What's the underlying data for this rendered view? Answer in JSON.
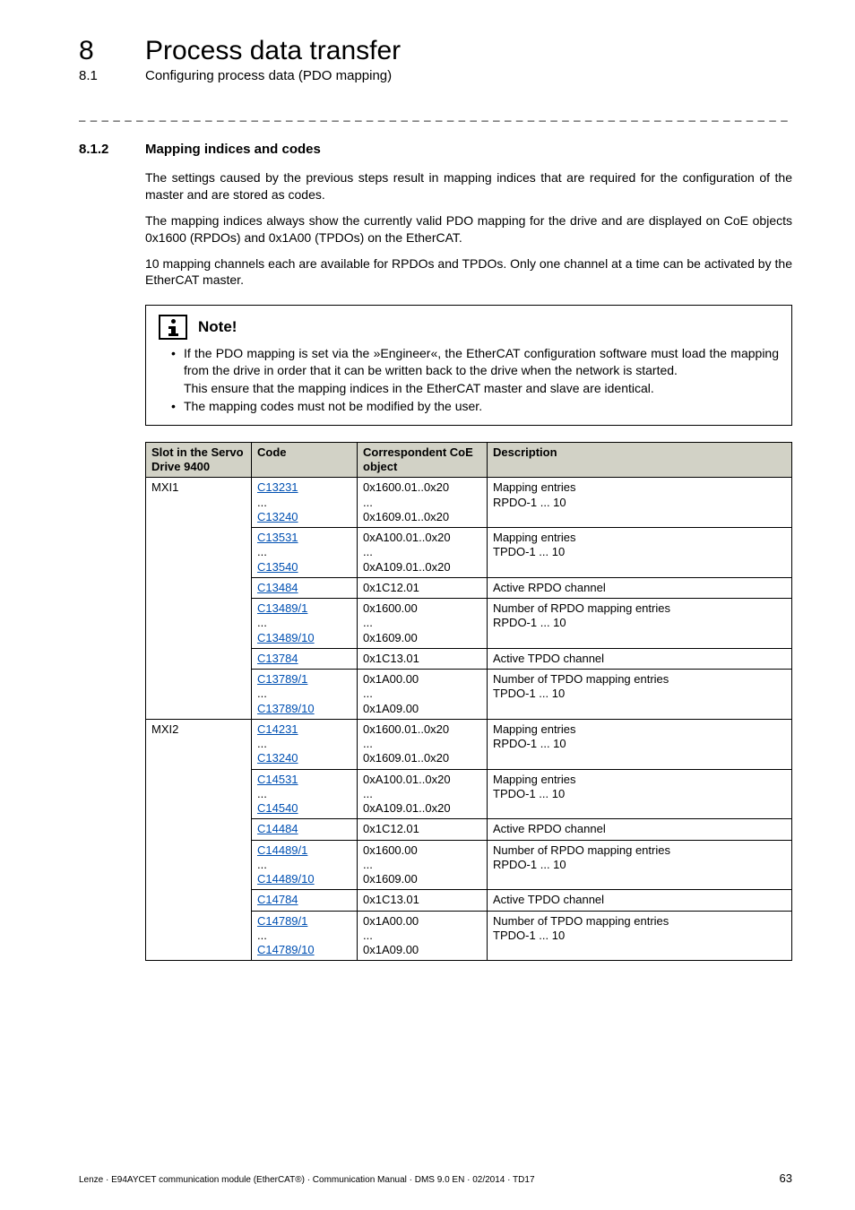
{
  "header": {
    "chapter_num": "8",
    "chapter_title": "Process data transfer",
    "section_num": "8.1",
    "section_title": "Configuring process data (PDO mapping)"
  },
  "separator": "_ _ _ _ _ _ _ _ _ _ _ _ _ _ _ _ _ _ _ _ _ _ _ _ _ _ _ _ _ _ _ _ _ _ _ _ _ _ _ _ _ _ _ _ _ _ _ _ _ _ _ _ _ _ _ _ _ _ _ _ _ _ _ _",
  "subsection": {
    "num": "8.1.2",
    "title": "Mapping indices and codes"
  },
  "paragraphs": {
    "p1": "The settings caused by the previous steps result in mapping indices that are required for the configuration of the master and are stored as codes.",
    "p2": "The mapping indices always show the currently valid PDO mapping for the drive and are displayed on CoE objects 0x1600 (RPDOs) and 0x1A00 (TPDOs) on the EtherCAT.",
    "p3": "10 mapping channels each are available for RPDOs and TPDOs. Only one channel at a time can be activated by the EtherCAT master."
  },
  "note": {
    "title": "Note!",
    "bullet1_a": "If the PDO mapping is set via the »Engineer«, the EtherCAT configuration software must load the mapping from the drive in order that it can be written back to the drive when the network is started.",
    "bullet1_sub": "This ensure that the mapping indices in the EtherCAT master and slave are identical.",
    "bullet2": "The mapping codes must not be modified by the user."
  },
  "table": {
    "headers": {
      "slot": "Slot in the Servo Drive 9400",
      "code": "Code",
      "obj": "Correspondent CoE object",
      "desc": "Description"
    },
    "groups": [
      {
        "slot": "MXI1",
        "rows": [
          {
            "code_a": "C13231",
            "code_b": "C13240",
            "obj_a": "0x1600.01..0x20",
            "obj_b": "0x1609.01..0x20",
            "desc_a": "Mapping entries",
            "desc_b": "RPDO-1 ... 10"
          },
          {
            "code_a": "C13531",
            "code_b": "C13540",
            "obj_a": "0xA100.01..0x20",
            "obj_b": "0xA109.01..0x20",
            "desc_a": "Mapping entries",
            "desc_b": "TPDO-1 ... 10"
          },
          {
            "code_a": "C13484",
            "obj_a": "0x1C12.01",
            "desc_a": "Active RPDO channel"
          },
          {
            "code_a": "C13489/1",
            "code_b": "C13489/10",
            "obj_a": "0x1600.00",
            "obj_b": "0x1609.00",
            "desc_a": "Number of RPDO mapping entries",
            "desc_b": "RPDO-1 ... 10"
          },
          {
            "code_a": "C13784",
            "obj_a": "0x1C13.01",
            "desc_a": "Active TPDO channel"
          },
          {
            "code_a": "C13789/1",
            "code_b": "C13789/10",
            "obj_a": "0x1A00.00",
            "obj_b": "0x1A09.00",
            "desc_a": "Number of TPDO mapping entries",
            "desc_b": "TPDO-1 ... 10"
          }
        ]
      },
      {
        "slot": "MXI2",
        "rows": [
          {
            "code_a": "C14231",
            "code_b": "C13240",
            "obj_a": "0x1600.01..0x20",
            "obj_b": "0x1609.01..0x20",
            "desc_a": "Mapping entries",
            "desc_b": "RPDO-1 ... 10"
          },
          {
            "code_a": "C14531",
            "code_b": "C14540",
            "obj_a": "0xA100.01..0x20",
            "obj_b": "0xA109.01..0x20",
            "desc_a": "Mapping entries",
            "desc_b": "TPDO-1 ... 10"
          },
          {
            "code_a": "C14484",
            "obj_a": "0x1C12.01",
            "desc_a": "Active RPDO channel"
          },
          {
            "code_a": "C14489/1",
            "code_b": "C14489/10",
            "obj_a": "0x1600.00",
            "obj_b": "0x1609.00",
            "desc_a": "Number of RPDO mapping entries",
            "desc_b": "RPDO-1 ... 10"
          },
          {
            "code_a": "C14784",
            "obj_a": "0x1C13.01",
            "desc_a": "Active TPDO channel"
          },
          {
            "code_a": "C14789/1",
            "code_b": "C14789/10",
            "obj_a": "0x1A00.00",
            "obj_b": "0x1A09.00",
            "desc_a": "Number of TPDO mapping entries",
            "desc_b": "TPDO-1 ... 10"
          }
        ]
      }
    ]
  },
  "footer": {
    "left": "Lenze · E94AYCET communication module (EtherCAT®) · Communication Manual · DMS 9.0 EN · 02/2014 · TD17",
    "page": "63"
  }
}
